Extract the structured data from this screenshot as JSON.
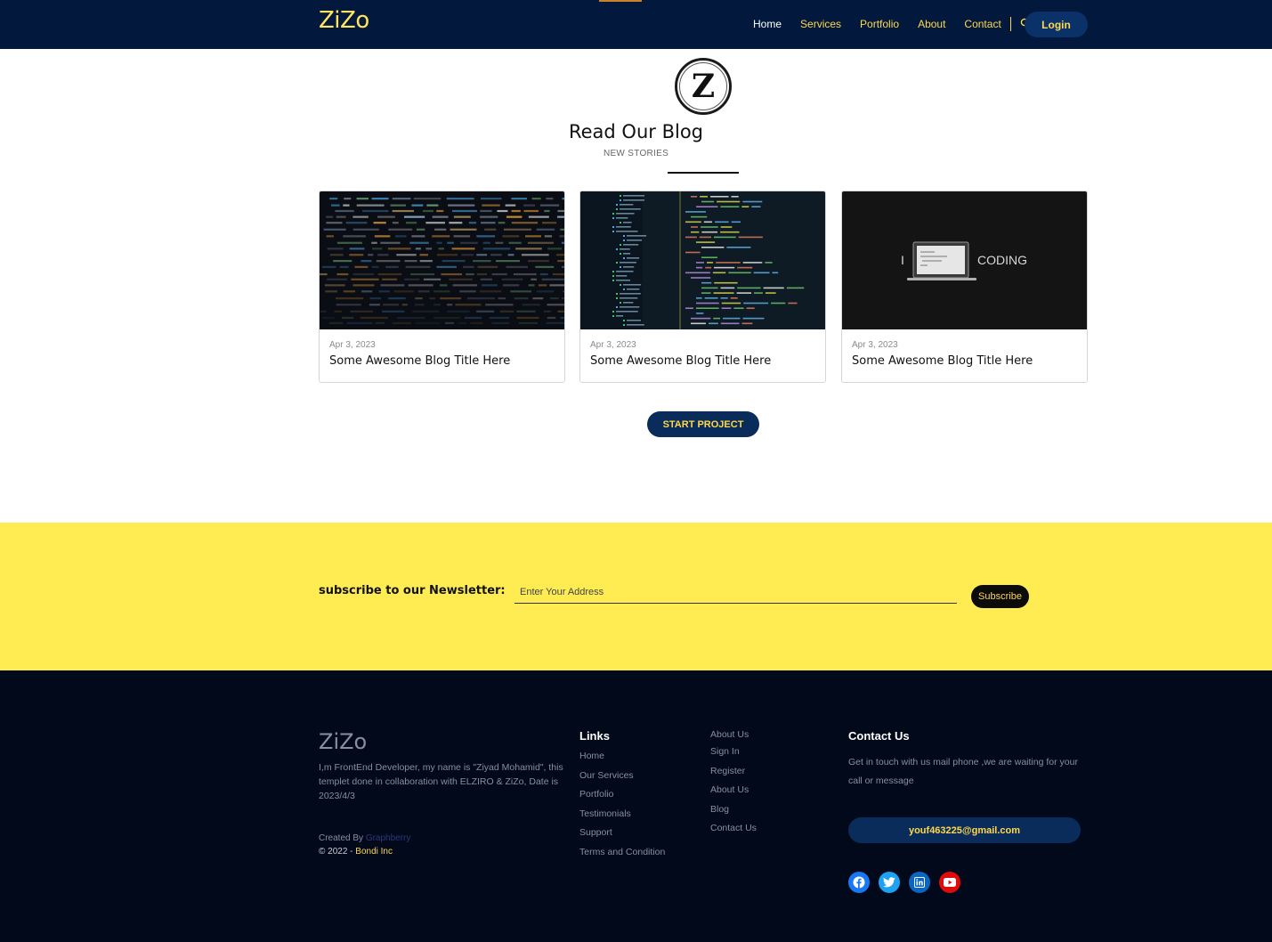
{
  "navbar": {
    "brand": "ZiZo",
    "links": [
      "Home",
      "Services",
      "Portfolio",
      "About",
      "Contact"
    ],
    "login_label": "Login",
    "colors": {
      "bg": "#02193d",
      "accent": "#ffd84d"
    }
  },
  "blog": {
    "logo_letter": "Z",
    "heading": "Read Our Blog",
    "subheading": "NEW STORIES",
    "cards": [
      {
        "date": "Apr 3, 2023",
        "title": "Some Awesome Blog Title Here",
        "image": "code-screen"
      },
      {
        "date": "Apr 3, 2023",
        "title": "Some Awesome Blog Title Here",
        "image": "code-editor"
      },
      {
        "date": "Apr 3, 2023",
        "title": "Some Awesome Blog Title Here",
        "image": "i-love-coding",
        "image_text": {
          "left": "I",
          "right": "CODING"
        }
      }
    ],
    "cta_label": "START PROJECT"
  },
  "newsletter": {
    "label": "subscribe to our Newsletter:",
    "placeholder": "Enter Your Address",
    "button_label": "Subscribe",
    "bg_color": "#ffec52"
  },
  "footer": {
    "brand": "ZiZo",
    "description": "I,m FrontEnd Developer, my name is \"Ziyad Mohamid\", this templet done in collaboration with ELZIRO & ZiZo, Date is 2023/4/3",
    "created_by_prefix": "Created By",
    "created_by_link": "Graphberry",
    "copyright_prefix": "© 2022 -",
    "copyright_brand": "Bondi Inc",
    "links_title": "Links",
    "links": [
      "Home",
      "Our Services",
      "Portfolio",
      "Testimonials",
      "Support",
      "Terms and Condition"
    ],
    "links2": [
      "About Us",
      "Sign In",
      "Register",
      "About Us",
      "Blog",
      "Contact Us"
    ],
    "contact_title": "Contact Us",
    "contact_text": "Get in touch with us mail phone ,we are waiting for your call or message",
    "email": "youf463225@gmail.com",
    "socials": [
      {
        "name": "facebook-icon",
        "color": "#1877f2"
      },
      {
        "name": "twitter-icon",
        "color": "#1da1f2"
      },
      {
        "name": "linkedin-icon",
        "color": "#0a66c2"
      },
      {
        "name": "youtube-icon",
        "color": "#ff0000"
      }
    ]
  }
}
